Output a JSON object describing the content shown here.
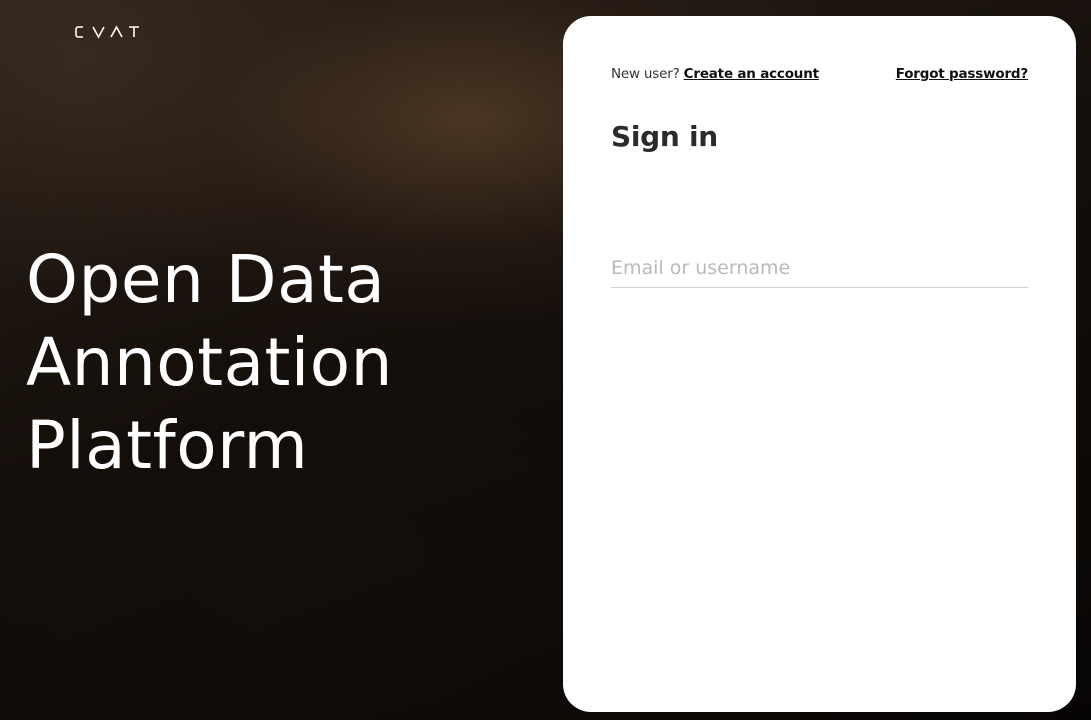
{
  "brand": {
    "logo_text": "CVAT"
  },
  "hero": {
    "lines": [
      "Open Data",
      "Annotation",
      "Platform"
    ]
  },
  "signin_card": {
    "new_user_label": "New user?",
    "create_account_link": "Create an account",
    "forgot_password_link": "Forgot password?",
    "title": "Sign in",
    "email_field": {
      "placeholder": "Email or username",
      "value": ""
    }
  },
  "colors": {
    "card_background": "#ffffff",
    "page_background": "#0a0706",
    "hero_text": "#ffffff",
    "link_text": "#111111",
    "placeholder_text": "#b9b9b9"
  }
}
